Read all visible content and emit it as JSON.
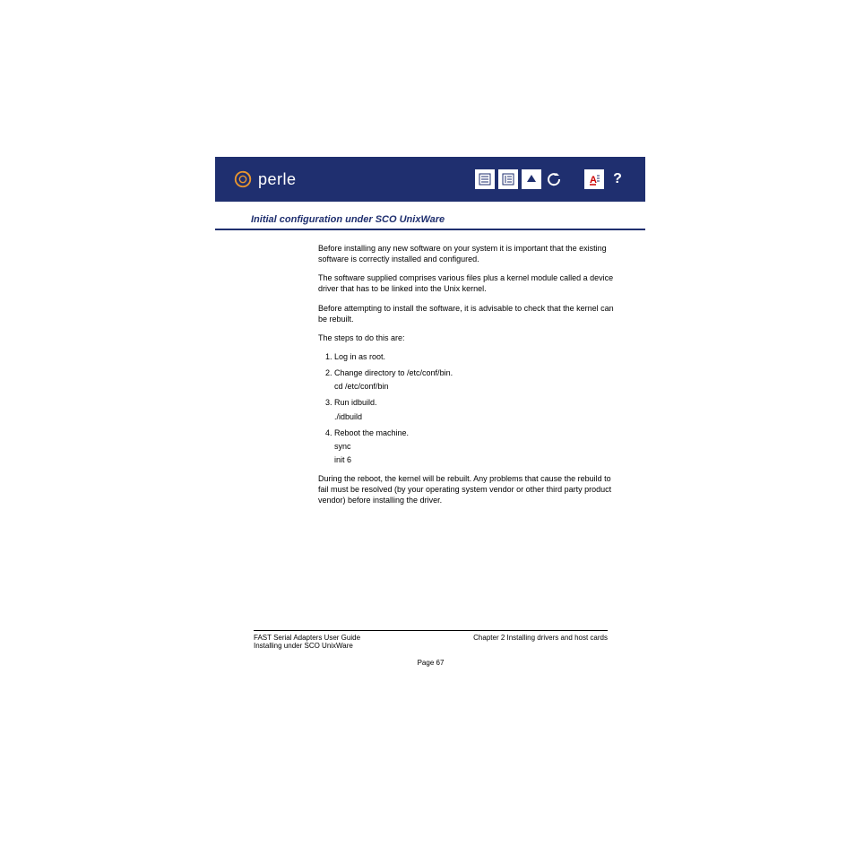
{
  "header": {
    "brand": "perle",
    "icons": [
      "toc-icon",
      "index-icon",
      "up-icon",
      "back-icon",
      "font-icon",
      "help-icon"
    ]
  },
  "section_title": "Initial configuration under SCO UnixWare",
  "content": {
    "p1": "Before installing any new software on your system it is important that the existing software is correctly installed and configured.",
    "p2": "The software supplied comprises various files plus a kernel module called a device driver that has to be linked into the Unix kernel.",
    "p3": "Before attempting to install the software, it is advisable to check that the kernel can be rebuilt.",
    "p4": "The steps to do this are:",
    "steps": {
      "s1": "Log in as root.",
      "s2": "Change directory to /etc/conf/bin.",
      "s2_cmd": "cd /etc/conf/bin",
      "s3": "Run idbuild.",
      "s3_cmd": "./idbuild",
      "s4": "Reboot the machine.",
      "s4_cmd1": "sync",
      "s4_cmd2": "init 6"
    },
    "p5": "During the reboot, the kernel will be rebuilt. Any problems that cause the rebuild to fail must be resolved (by your operating system vendor or other third party product vendor) before installing the driver."
  },
  "footer": {
    "left1": "FAST Serial Adapters User Guide",
    "left2": "Installing under SCO UnixWare",
    "right": "Chapter 2 Installing drivers and host cards",
    "page": "Page 67"
  }
}
